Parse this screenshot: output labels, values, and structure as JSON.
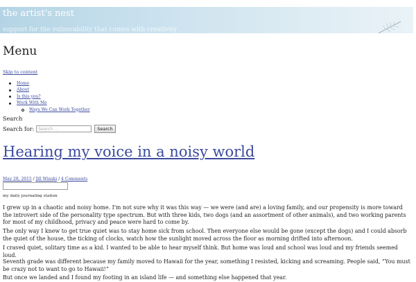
{
  "site": {
    "title": "the artist's nest",
    "tagline": "support for the vulnerability that comes with creativity"
  },
  "menu": {
    "heading": "Menu",
    "skip_link": "Skip to content",
    "items": [
      {
        "label": "Home"
      },
      {
        "label": "About"
      },
      {
        "label": "Is this you?"
      },
      {
        "label": "Work With Me"
      }
    ],
    "subitems": [
      {
        "label": "Ways We Can Work Together"
      }
    ]
  },
  "search": {
    "heading": "Search",
    "label": "Search for:",
    "placeholder": "Search …",
    "button": "Search"
  },
  "post": {
    "title": "Hearing my voice in a noisy world",
    "date": "May 28, 2015",
    "author": "Jill Winski",
    "comments": "4 Comments",
    "sep": " / ",
    "caption": "my daily journaling station",
    "paragraphs": [
      "I grew up in a chaotic and noisy home. I'm not sure why it was this way — we were (and are) a loving family, and our propensity is more toward the introvert side of the personality type spectrum. But with three kids, two dogs (and an assortment of other animals), and two working parents for most of my childhood, privacy and peace were hard to come by.",
      "The only way I knew to get true quiet was to stay home sick from school. Then everyone else would be gone (except the dogs) and I could absorb the quiet of the house, the ticking of clocks, watch how the sunlight moved across the floor as morning drifted into afternoon.",
      "I craved quiet, solitary time as a kid. I wanted to be able to hear myself think. But home was loud and school was loud and my friends seemed loud.",
      "Seventh grade was different because my family moved to Hawaii for the year, something I resisted, kicking and screaming. People said, “You must be crazy not to want to go to Hawaii!”",
      "But once we landed and I found my footing in an island life — and something else happened that year."
    ]
  },
  "colors": {
    "link": "#3b4a9e",
    "header_start": "#b4d4e5",
    "header_end": "#eaf2f7"
  }
}
